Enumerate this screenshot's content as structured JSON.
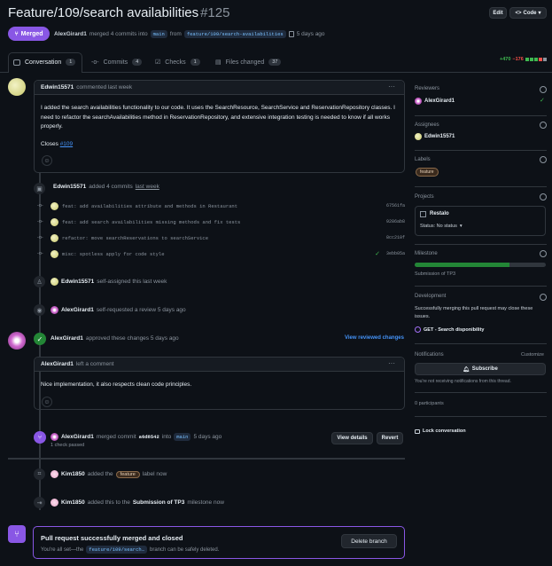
{
  "header": {
    "title": "Feature/109/search availabilities",
    "number": "#125",
    "edit_label": "Edit",
    "code_label": "Code",
    "state_label": "Merged",
    "author": "AlexGirard1",
    "merged_text": "merged 4 commits into",
    "base_branch": "main",
    "from_text": "from",
    "head_branch": "feature/109/search-availabilities",
    "time": "5 days ago"
  },
  "tabs": [
    {
      "label": "Conversation",
      "count": "1"
    },
    {
      "label": "Commits",
      "count": "4"
    },
    {
      "label": "Checks",
      "count": "1"
    },
    {
      "label": "Files changed",
      "count": "37"
    }
  ],
  "diffstat": {
    "added": "+470",
    "removed": "−176"
  },
  "comment1": {
    "author": "Edwin15571",
    "meta": "commented last week",
    "body_p1": "I added the search availabilities functionality to our code. It uses the SearchResource, SearchService and ReservationRepository classes. I need to refactor the searchAvailabilities method in ReservationRepository, and extensive integration testing is needed to know if all works properly.",
    "closes_label": "Closes",
    "closes_ref": "#109"
  },
  "commits_event": {
    "author": "Edwin15571",
    "text": "added 4 commits",
    "time": "last week"
  },
  "commits": [
    {
      "message": "feat: add availabilities attribute and methods in Restaurant",
      "sha": "67561fa"
    },
    {
      "message": "feat: add search availabilities missing methods and fix tests",
      "sha": "9286ab8"
    },
    {
      "message": "refactor: move searchReservations to searchService",
      "sha": "8cc210f"
    },
    {
      "message": "misc: spotless apply for code style",
      "sha": "3ebb05a"
    }
  ],
  "assign_event": {
    "author": "Edwin15571",
    "text": "self-assigned this last week"
  },
  "review_request_event": {
    "author": "AlexGirard1",
    "text": "self-requested a review 5 days ago"
  },
  "approval": {
    "author": "AlexGirard1",
    "text": "approved these changes 5 days ago",
    "link": "View reviewed changes"
  },
  "comment2": {
    "author": "AlexGirard1",
    "meta": "left a comment",
    "body": "Nice implementation, it also respects clean code principles."
  },
  "merge_event": {
    "author": "AlexGirard1",
    "text": "merged commit",
    "sha": "a6d8542",
    "into": "into",
    "branch": "main",
    "time": "5 days ago",
    "checks": "1 check passed",
    "view_details": "View details",
    "revert": "Revert"
  },
  "label_event": {
    "author": "Kim1850",
    "pre": "added the",
    "label": "feature",
    "post": "label now"
  },
  "milestone_event": {
    "author": "Kim1850",
    "pre": "added this to the",
    "milestone": "Submission of TP3",
    "post": "milestone now"
  },
  "merged_box": {
    "title": "Pull request successfully merged and closed",
    "pre": "You're all set—the",
    "branch": "feature/109/search…",
    "post": "branch can be safely deleted.",
    "delete_label": "Delete branch"
  },
  "sidebar": {
    "reviewers_h": "Reviewers",
    "reviewer": "AlexGirard1",
    "assignees_h": "Assignees",
    "assignee": "Edwin15571",
    "labels_h": "Labels",
    "label": "feature",
    "projects_h": "Projects",
    "project_name": "Restalo",
    "project_status": "Status: No status",
    "milestone_h": "Milestone",
    "milestone_name": "Submission of TP3",
    "milestone_progress": 0.72,
    "development_h": "Development",
    "development_text": "Successfully merging this pull request may close these issues.",
    "issue": "GET - Search disponibility",
    "notifications_h": "Notifications",
    "customize": "Customize",
    "subscribe": "Subscribe",
    "notif_text": "You're not receiving notifications from this thread.",
    "participants": "0 participants",
    "lock": "Lock conversation"
  },
  "colors": {
    "merged": "#8957e5",
    "accent": "#4493f8",
    "success": "#238636",
    "danger": "#f85149"
  }
}
